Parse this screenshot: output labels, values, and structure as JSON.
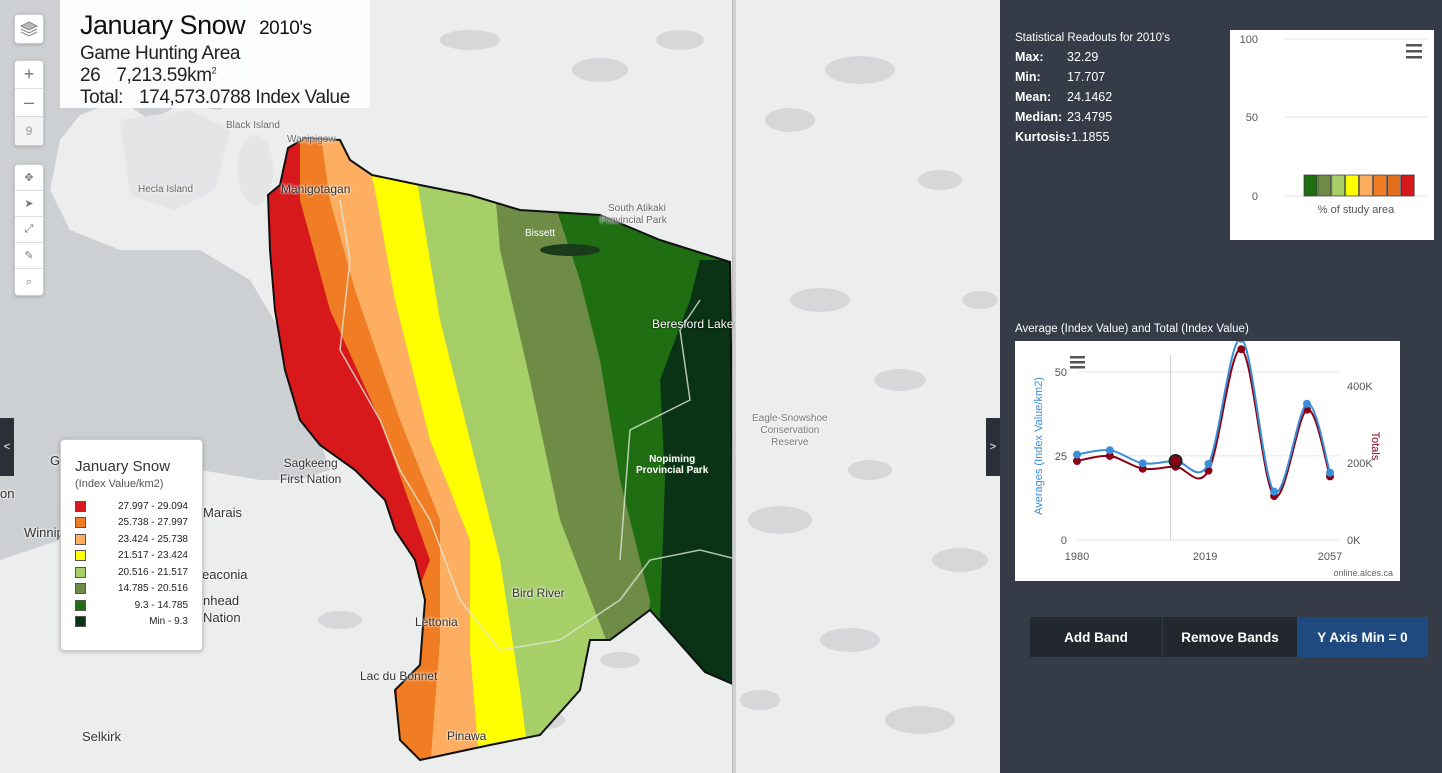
{
  "title": {
    "layer": "January Snow",
    "decade": "2010's",
    "region": "Game Hunting Area 26",
    "area": "7,213.59km",
    "area_sup": "2",
    "total_label": "Total:",
    "total_value": "174,573.0788 Index Value"
  },
  "controls": {
    "layers_icon": "layers-icon",
    "zoom_in": "+",
    "zoom_out": "–",
    "zoom_level": "9",
    "tools": [
      "move-icon",
      "select-icon",
      "extent-icon",
      "measure-icon",
      "search-icon"
    ],
    "left_tab": "<",
    "right_tab": ">"
  },
  "places": {
    "black_island": "Black Island",
    "hecla_island": "Hecla Island",
    "manigotagan": "Manigotagan",
    "wanipigow": "Wanipigow",
    "bissett": "Bissett",
    "south_atikaki": "South Atikaki",
    "provincial_park": "Provincial Park",
    "beresford_lake": "Beresford Lake",
    "eagle_snowshoe_1": "Eagle-Snowshoe",
    "eagle_snowshoe_2": "Conservation",
    "eagle_snowshoe_3": "Reserve",
    "nopiming_1": "Nopiming",
    "nopiming_2": "Provincial Park",
    "sagkeeng_1": "Sagkeeng",
    "sagkeeng_2": "First Nation",
    "gi": "Gi",
    "on": "on",
    "winnipeg": "Winnip",
    "marais": "Marais",
    "seaconia": "eaconia",
    "nhead": "nhead",
    "nation": "Nation",
    "bird_river": "Bird River",
    "lettonia": "Lettonia",
    "lac_du_bonnet": "Lac du Bonnet",
    "pinawa": "Pinawa",
    "selkirk": "Selkirk"
  },
  "legend": {
    "title": "January Snow",
    "subtitle": "(Index Value/km2)",
    "items": [
      {
        "label": "27.997 - 29.094",
        "color": "#d7191c"
      },
      {
        "label": "25.738 - 27.997",
        "color": "#f07c23"
      },
      {
        "label": "23.424 - 25.738",
        "color": "#fdae61"
      },
      {
        "label": "21.517 - 23.424",
        "color": "#ffff00"
      },
      {
        "label": "20.516 - 21.517",
        "color": "#a6cf68"
      },
      {
        "label": "14.785 - 20.516",
        "color": "#6f8c47"
      },
      {
        "label": "9.3 - 14.785",
        "color": "#1f6e12"
      },
      {
        "label": "Min - 9.3",
        "color": "#0a3315"
      }
    ]
  },
  "stats": {
    "title": "Statistical Readouts for 2010's",
    "rows": [
      {
        "k": "Max:",
        "v": "32.29"
      },
      {
        "k": "Min:",
        "v": "17.707"
      },
      {
        "k": "Mean:",
        "v": "24.1462"
      },
      {
        "k": "Median:",
        "v": "23.4795"
      },
      {
        "k": "Kurtosis:",
        "v": "-1.1855"
      }
    ]
  },
  "chart1": {
    "menu_icon": "hamburger-icon",
    "y_ticks": [
      "100",
      "50",
      "0"
    ],
    "xlabel": "% of study area",
    "colors": [
      "#1f6e12",
      "#6f8c47",
      "#a6cf68",
      "#ffff00",
      "#fdae61",
      "#f07c23",
      "#e0701e",
      "#d7191c"
    ]
  },
  "chart2": {
    "title": "Average (Index Value) and Total (Index Value)",
    "menu_icon": "hamburger-icon",
    "ylabel_left": "Averages (Index Value/km2)",
    "ylabel_right": "Totals",
    "left_ticks": [
      "50",
      "25",
      "0"
    ],
    "right_ticks": [
      "400K",
      "200K",
      "0K"
    ],
    "x_ticks": [
      "1980",
      "2019",
      "2057"
    ],
    "credit": "online.alces.ca"
  },
  "chart_data": {
    "type": "line",
    "title": "Average (Index Value) and Total (Index Value)",
    "xlabel": "",
    "ylabel": "Averages (Index Value/km2)",
    "ylabel_right": "Totals",
    "x": [
      1980,
      1990,
      2000,
      2010,
      2020,
      2030,
      2040,
      2050,
      2057
    ],
    "ylim": [
      0,
      55
    ],
    "ylim_right": [
      0,
      480000
    ],
    "series": [
      {
        "name": "Averages",
        "axis": "left",
        "color": "#3a8ed8",
        "values": [
          25.4,
          26.7,
          22.8,
          23.5,
          22.6,
          59.8,
          14.4,
          40.5,
          20.0
        ]
      },
      {
        "name": "Totals",
        "axis": "right",
        "color": "#8b0014",
        "values": [
          205000,
          218000,
          185000,
          190000,
          180000,
          495000,
          114000,
          338000,
          165000
        ]
      }
    ]
  },
  "buttons": {
    "add_band": "Add Band",
    "remove_bands": "Remove Bands",
    "ymin": "Y Axis Min = 0"
  }
}
